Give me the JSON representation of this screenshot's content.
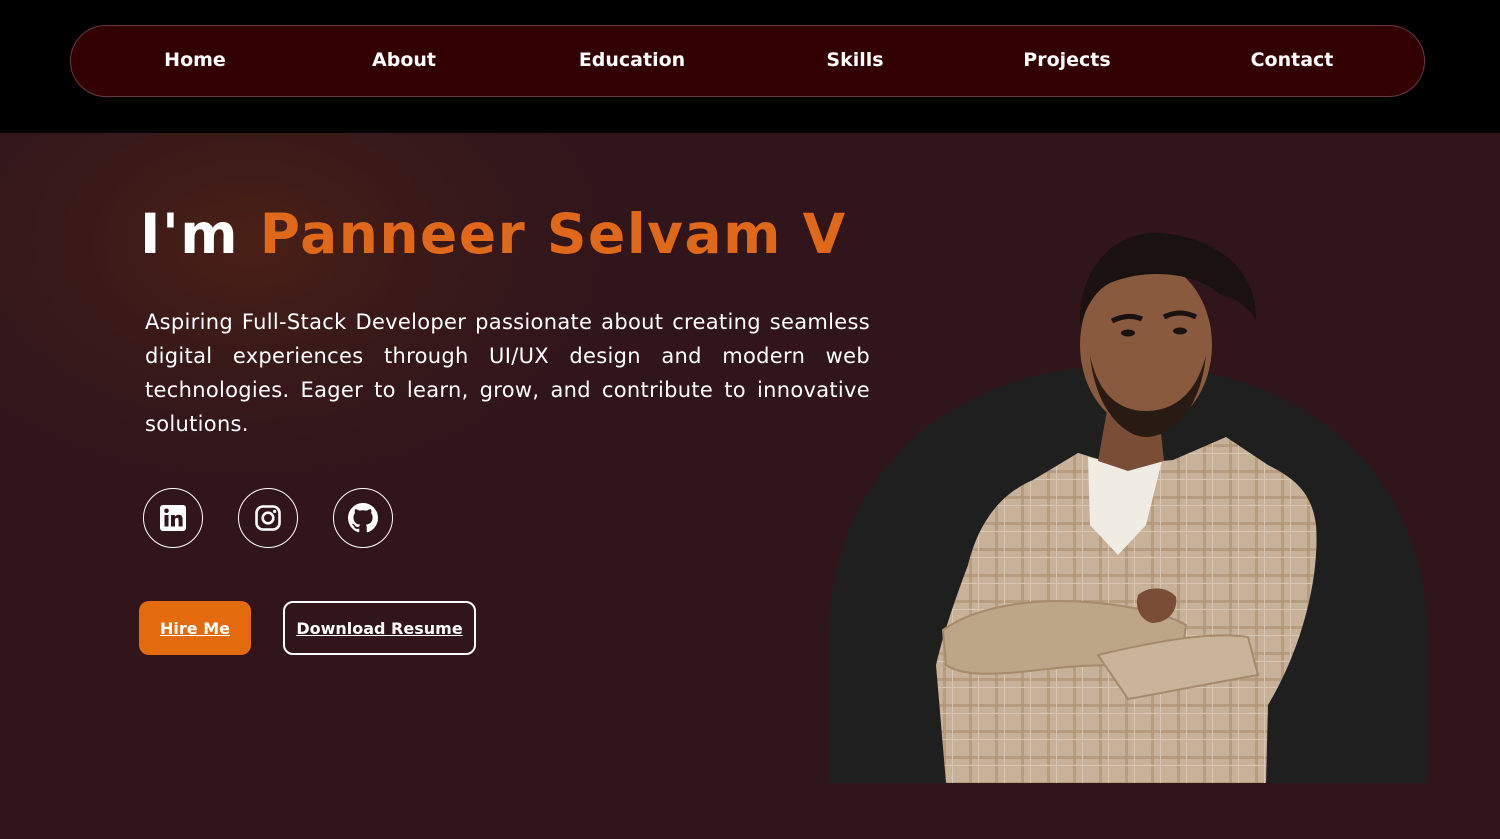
{
  "nav": {
    "items": [
      "Home",
      "About",
      "Education",
      "Skills",
      "Projects",
      "Contact"
    ]
  },
  "hero": {
    "greeting": "I'm",
    "name": "Panneer Selvam V",
    "description": "Aspiring Full-Stack Developer passionate about creating seamless digital experiences through UI/UX design and modern web technologies. Eager to learn, grow, and contribute to innovative solutions.",
    "social_icons": [
      "linkedin-icon",
      "instagram-icon",
      "github-icon"
    ],
    "hire_label": "Hire Me",
    "resume_label": "Download Resume"
  },
  "colors": {
    "accent": "#e0681a",
    "button": "#e36a0d",
    "nav_bg": "#330002",
    "page_bg": "#30151a"
  }
}
